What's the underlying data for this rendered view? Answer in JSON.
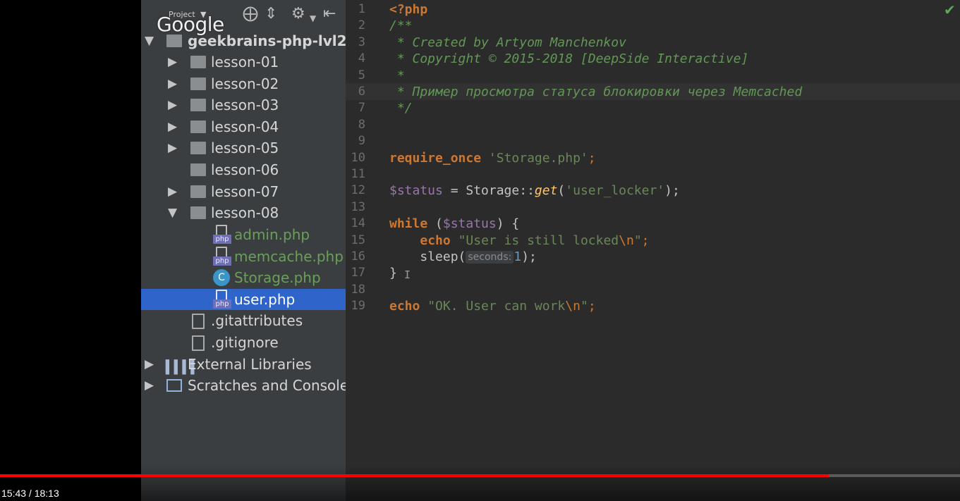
{
  "sidebar": {
    "toolbar": {
      "label": "Project",
      "caret": "▼",
      "icons": [
        "crosshair-icon",
        "collapse-all-icon",
        "gear-icon",
        "hide-panel-icon"
      ],
      "watermark": "Google"
    },
    "tree": [
      {
        "label": "geekbrains-php-lvl2",
        "type": "folder",
        "expanded": true
      },
      {
        "label": "lesson-01",
        "type": "folder",
        "expanded": false
      },
      {
        "label": "lesson-02",
        "type": "folder",
        "expanded": false
      },
      {
        "label": "lesson-03",
        "type": "folder",
        "expanded": false
      },
      {
        "label": "lesson-04",
        "type": "folder",
        "expanded": false
      },
      {
        "label": "lesson-05",
        "type": "folder",
        "expanded": false
      },
      {
        "label": "lesson-06",
        "type": "folder",
        "expanded": null
      },
      {
        "label": "lesson-07",
        "type": "folder",
        "expanded": false
      },
      {
        "label": "lesson-08",
        "type": "folder",
        "expanded": true
      },
      {
        "label": "admin.php",
        "type": "php",
        "badge": "php"
      },
      {
        "label": "memcache.php",
        "type": "php",
        "badge": "php"
      },
      {
        "label": "Storage.php",
        "type": "class",
        "badge": "C"
      },
      {
        "label": "user.php",
        "type": "php",
        "badge": "php",
        "selected": true
      },
      {
        "label": ".gitattributes",
        "type": "file"
      },
      {
        "label": ".gitignore",
        "type": "file"
      },
      {
        "label": "External Libraries",
        "type": "libraries"
      },
      {
        "label": "Scratches and Consoles",
        "type": "scratches"
      }
    ]
  },
  "editor": {
    "line_numbers": [
      "1",
      "2",
      "3",
      "4",
      "5",
      "6",
      "7",
      "8",
      "9",
      "10",
      "11",
      "12",
      "13",
      "14",
      "15",
      "16",
      "17",
      "18",
      "19"
    ],
    "tokens": {
      "l1": "<?php",
      "l2": "/**",
      "l3": " * Created by Artyom Manchenkov",
      "l4": " * Copyright © 2015-2018 [DeepSide Interactive]",
      "l5": " *",
      "l6": " * Пример просмотра статуса блокировки через Memcached",
      "l7": " */",
      "l10_kw": "require_once",
      "l10_str": "'Storage.php'",
      "l10_end": ";",
      "l12_var": "$status",
      "l12_mid": " = Storage::",
      "l12_fn": "get",
      "l12_open": "(",
      "l12_str": "'user_locker'",
      "l12_end": ");",
      "l14_kw": "while",
      "l14_open": " (",
      "l14_var": "$status",
      "l14_end": ") {",
      "l15_kw": "echo",
      "l15_str": "\"User is still locked",
      "l15_esc": "\\n",
      "l15_str2": "\"",
      "l15_end": ";",
      "l16_fn": "sleep(",
      "l16_hint": "seconds:",
      "l16_num": "1",
      "l16_end": ");",
      "l17": "}",
      "l19_kw": "echo",
      "l19_str": "\"OK. User can work",
      "l19_esc": "\\n",
      "l19_str2": "\"",
      "l19_end": ";"
    },
    "status_icon": "checkmark-icon",
    "cursor_glyph": "I"
  },
  "video": {
    "current_time": "15:43",
    "separator": " / ",
    "duration": "18:13",
    "progress_fraction": 0.863
  },
  "colors": {
    "keyword": "#cc7832",
    "docComment": "#629755",
    "string": "#6a8759",
    "variable": "#9876aa",
    "function": "#ffc66d",
    "number": "#6897bb",
    "selection": "#2f65ca",
    "progress": "#ff0000"
  }
}
